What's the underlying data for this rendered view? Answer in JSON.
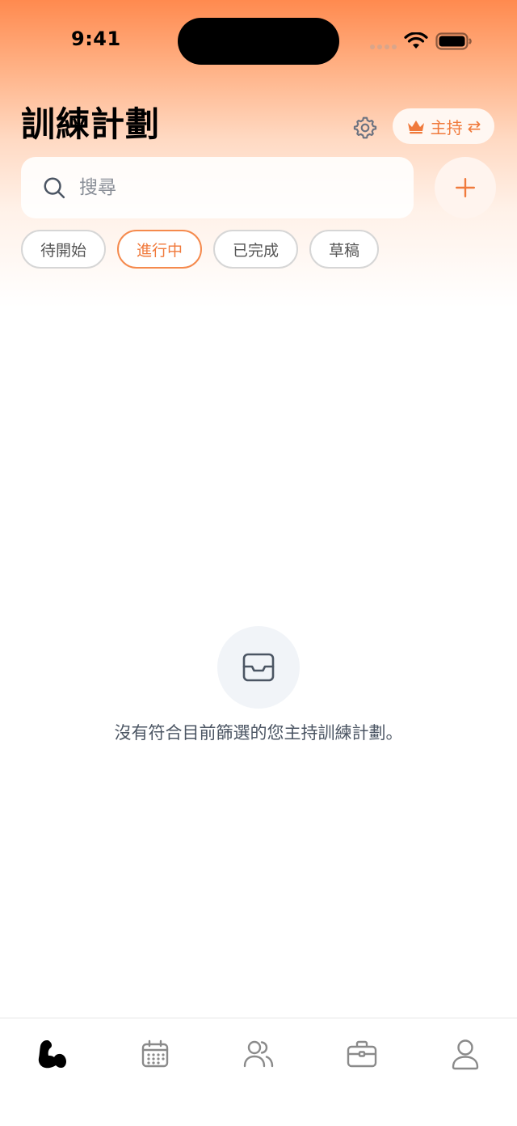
{
  "status_bar": {
    "time": "9:41"
  },
  "header": {
    "title": "訓練計劃",
    "settings_icon": "gear-icon",
    "role_switch": {
      "label": "主持",
      "icon": "crown-icon",
      "swap_glyph": "⇄"
    }
  },
  "search": {
    "placeholder": "搜尋",
    "value": ""
  },
  "add_button": {
    "icon": "plus-icon"
  },
  "filters": [
    {
      "label": "待開始",
      "active": false
    },
    {
      "label": "進行中",
      "active": true
    },
    {
      "label": "已完成",
      "active": false
    },
    {
      "label": "草稿",
      "active": false
    }
  ],
  "empty_state": {
    "icon": "inbox-icon",
    "message": "沒有符合目前篩選的您主持訓練計劃。"
  },
  "tab_bar": {
    "tabs": [
      {
        "icon": "muscle-icon",
        "active": true
      },
      {
        "icon": "calendar-icon",
        "active": false
      },
      {
        "icon": "users-icon",
        "active": false
      },
      {
        "icon": "briefcase-icon",
        "active": false
      },
      {
        "icon": "profile-icon",
        "active": false
      }
    ]
  },
  "colors": {
    "accent": "#f07a3c",
    "gradient_top": "#ff8a4f",
    "chip_border": "#d6d6d6",
    "icon_gray": "#8a8a8a"
  }
}
